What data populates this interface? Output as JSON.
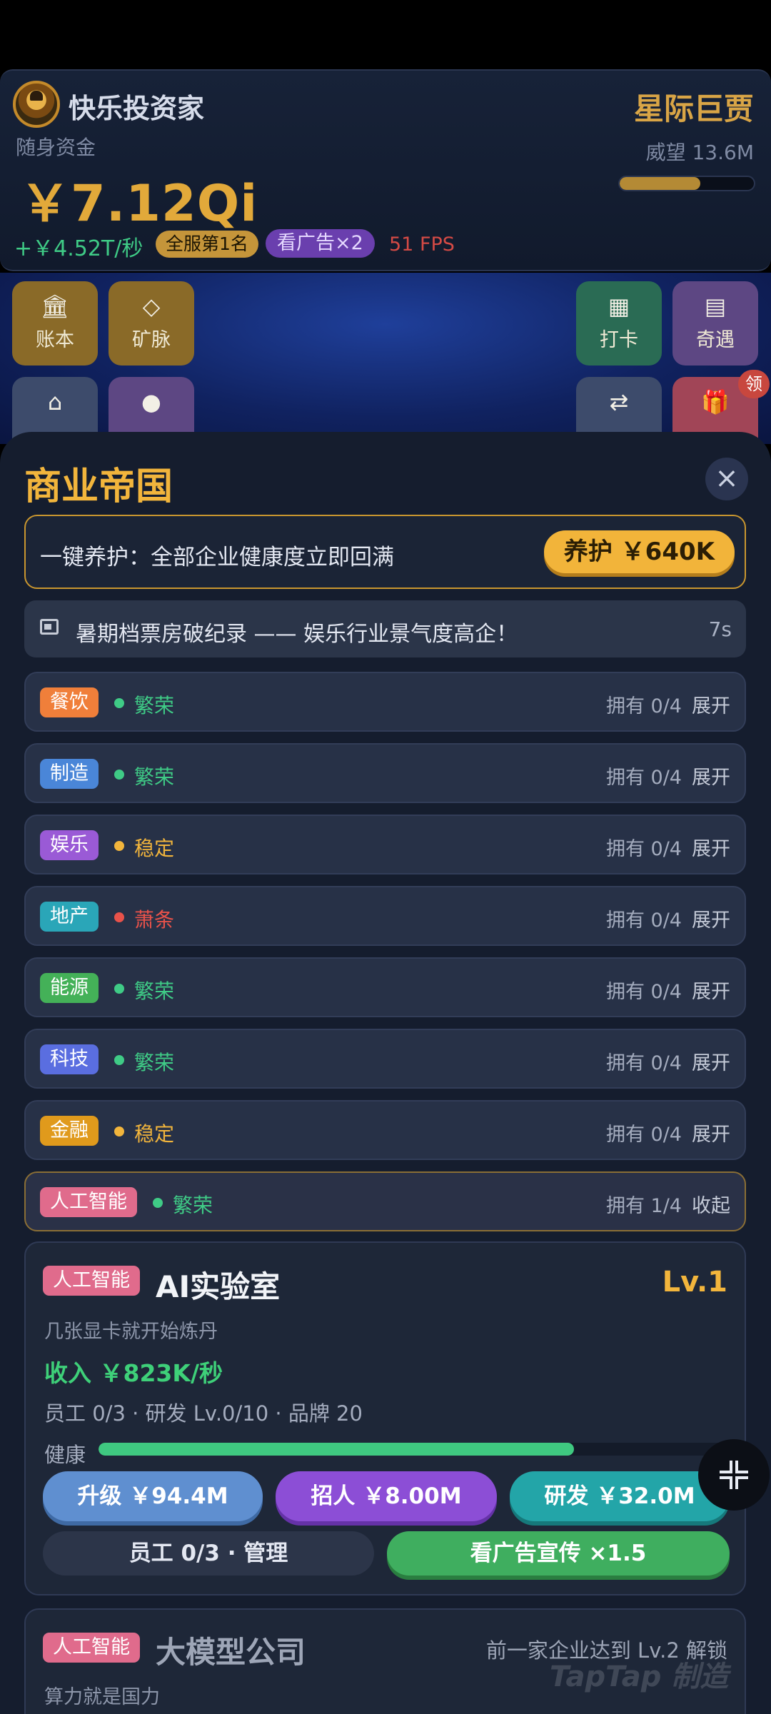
{
  "hud": {
    "player_name": "快乐投资家",
    "cash_label": "随身资金",
    "cash_value": "￥7.12Qi",
    "income_rate": "+￥4.52T/秒",
    "rank_badge": "全服第1名",
    "ad_badge": "看广告×2",
    "fps": "51 FPS",
    "title": "星际巨贾",
    "prestige": "威望 13.6M",
    "prestige_progress": 0.6
  },
  "scene": {
    "tiles": [
      {
        "label": "账本",
        "icon": "bank-icon"
      },
      {
        "label": "矿脉",
        "icon": "diamond-icon"
      },
      {
        "label": "打卡",
        "icon": "calendar-icon"
      },
      {
        "label": "奇遇",
        "icon": "news-icon"
      }
    ],
    "claim_badge": "领"
  },
  "sheet": {
    "title": "商业帝国",
    "maintain": {
      "text": "一键养护：全部企业健康度立即回满",
      "button": "养护 ￥640K"
    },
    "news": {
      "text": "暑期档票房破纪录 —— 娱乐行业景气度高企！",
      "timer": "7s"
    },
    "industries": [
      {
        "tag": "餐饮",
        "status": "繁荣",
        "owned": "拥有 0/4",
        "action": "展开",
        "tag_color": "#f07f3a",
        "status_color": "#3fcb86"
      },
      {
        "tag": "制造",
        "status": "繁荣",
        "owned": "拥有 0/4",
        "action": "展开",
        "tag_color": "#4a86d8",
        "status_color": "#3fcb86"
      },
      {
        "tag": "娱乐",
        "status": "稳定",
        "owned": "拥有 0/4",
        "action": "展开",
        "tag_color": "#9a5ad6",
        "status_color": "#f2b53c"
      },
      {
        "tag": "地产",
        "status": "萧条",
        "owned": "拥有 0/4",
        "action": "展开",
        "tag_color": "#2aa6b8",
        "status_color": "#e8524a"
      },
      {
        "tag": "能源",
        "status": "繁荣",
        "owned": "拥有 0/4",
        "action": "展开",
        "tag_color": "#44b158",
        "status_color": "#3fcb86"
      },
      {
        "tag": "科技",
        "status": "繁荣",
        "owned": "拥有 0/4",
        "action": "展开",
        "tag_color": "#5a6ee0",
        "status_color": "#3fcb86"
      },
      {
        "tag": "金融",
        "status": "稳定",
        "owned": "拥有 0/4",
        "action": "展开",
        "tag_color": "#e09a1c",
        "status_color": "#f2b53c"
      },
      {
        "tag": "人工智能",
        "status": "繁荣",
        "owned": "拥有 1/4",
        "action": "收起",
        "tag_color": "#e06b8c",
        "status_color": "#3fcb86"
      }
    ],
    "company": {
      "tag": "人工智能",
      "name": "AI实验室",
      "level": "Lv.1",
      "description": "几张显卡就开始炼丹",
      "income": "收入 ￥823K/秒",
      "stats": "员工 0/3 · 研发 Lv.0/10 · 品牌 20",
      "health_label": "健康",
      "health": 0.74,
      "buttons": {
        "upgrade": "升级 ￥94.4M",
        "hire": "招人 ￥8.00M",
        "research": "研发 ￥32.0M",
        "manage": "员工 0/3 · 管理",
        "ad": "看广告宣传 ×1.5"
      }
    },
    "locked_company": {
      "tag": "人工智能",
      "name": "大模型公司",
      "hint": "前一家企业达到 Lv.2 解锁",
      "description": "算力就是国力"
    }
  },
  "watermark": "TapTap 制造"
}
